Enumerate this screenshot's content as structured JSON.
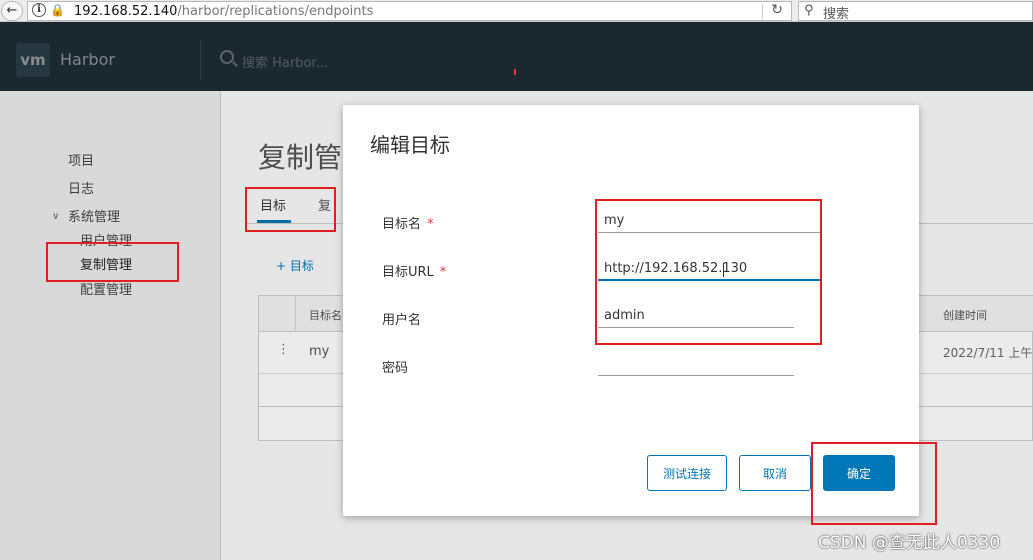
{
  "browser": {
    "url_host": "192.168.52.140",
    "url_path": "/harbor/replications/endpoints",
    "search_placeholder": "搜索"
  },
  "header": {
    "logo": "vm",
    "app_name": "Harbor",
    "search_placeholder": "搜索 Harbor..."
  },
  "sidebar": {
    "items": [
      "项目",
      "日志",
      "系统管理",
      "用户管理",
      "复制管理",
      "配置管理"
    ]
  },
  "main": {
    "title": "复制管",
    "tabs": [
      "目标",
      "复"
    ],
    "add_button": "+ 目标",
    "grid": {
      "col_name": "目标名",
      "col_created": "创建时间",
      "row_name": "my",
      "row_created": "2022/7/11 上午"
    }
  },
  "modal": {
    "title": "编辑目标",
    "fields": {
      "name_label": "目标名",
      "name_value": "my",
      "url_label": "目标URL",
      "url_value": "http://192.168.52.130",
      "user_label": "用户名",
      "user_value": "admin",
      "password_label": "密码",
      "password_value": "",
      "required_mark": "*"
    },
    "buttons": {
      "test": "测试连接",
      "cancel": "取消",
      "ok": "确定"
    }
  },
  "watermark": "CSDN @查无此人0330",
  "colors": {
    "accent": "#0077b8",
    "annotation": "#e02020",
    "header_bg": "#2c3e4a"
  }
}
